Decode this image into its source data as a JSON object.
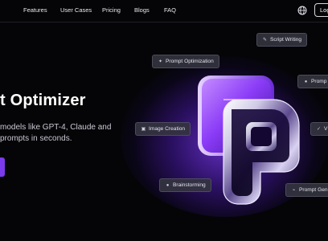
{
  "nav": {
    "items": [
      "Features",
      "User Cases",
      "Pricing",
      "Blogs",
      "FAQ"
    ],
    "login_label": "Log"
  },
  "hero": {
    "title": "t Optimizer",
    "subtitle_line1": "models like GPT-4, Claude and",
    "subtitle_line2": "prompts in seconds."
  },
  "tags": {
    "script_writing": "Script Writing",
    "prompt_optimization": "Prompt Optimization",
    "prompt_right": "Promp",
    "image_creation": "Image Creation",
    "v_right": "V",
    "brainstorming": "Brainstorming",
    "prompt_gen": "Prompt Gen"
  },
  "colors": {
    "accent": "#7c3aed",
    "glow": "#8a3cff",
    "background": "#050507"
  },
  "icons": [
    "globe-icon",
    "script-icon",
    "wand-icon",
    "image-icon",
    "lightbulb-icon",
    "user-icon"
  ]
}
